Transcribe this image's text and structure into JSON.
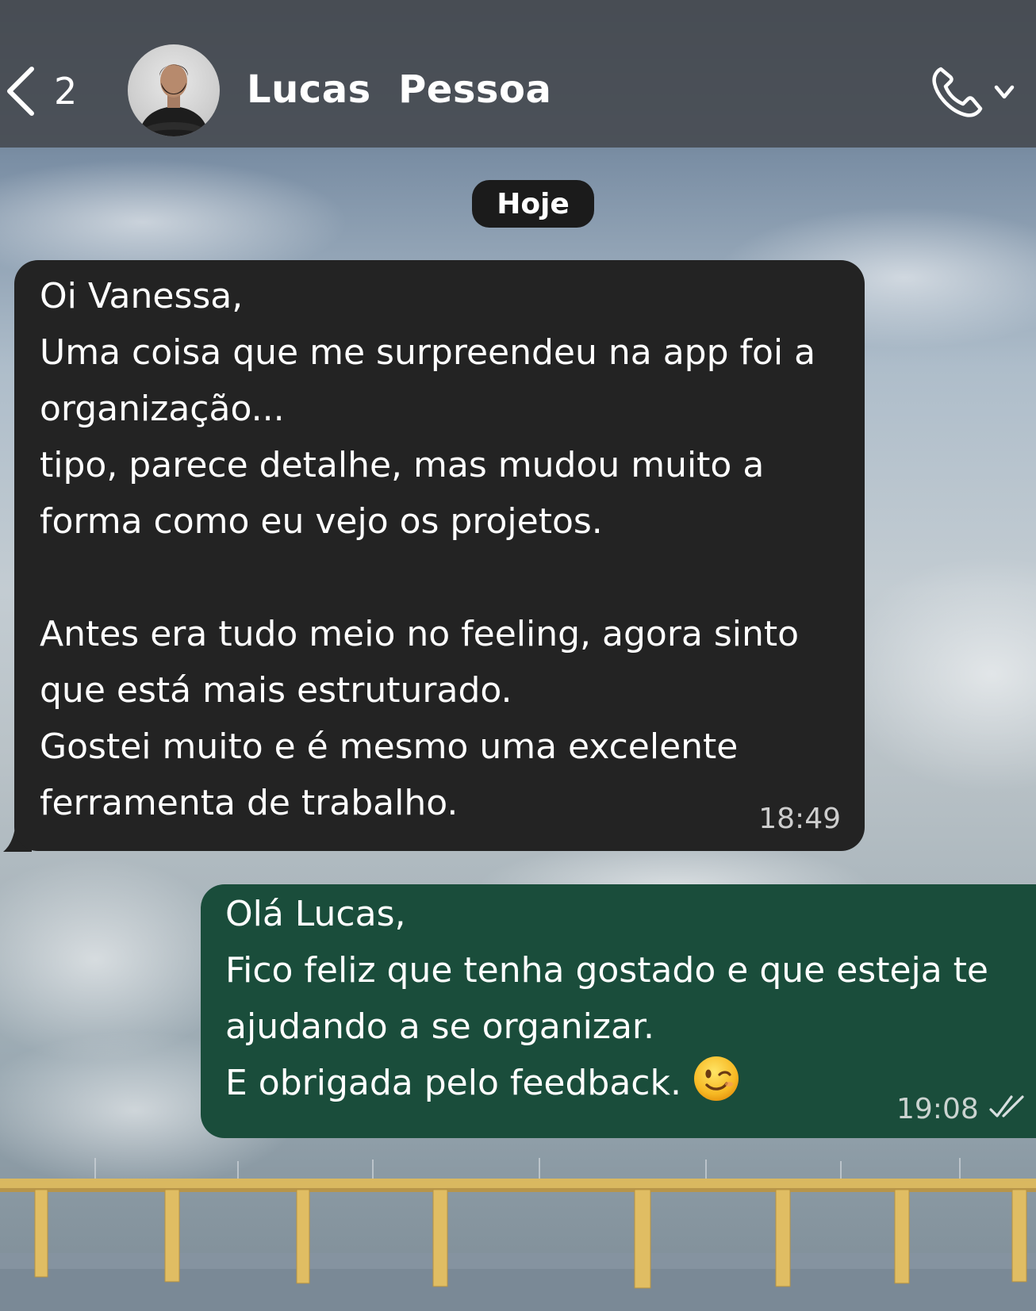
{
  "header": {
    "back_count": "2",
    "contact_name": "Lucas  Pessoa",
    "call_icon": "phone-icon",
    "dropdown_icon": "chevron-down-icon",
    "background": "#484c52"
  },
  "date_divider": {
    "label": "Hoje"
  },
  "messages": [
    {
      "direction": "incoming",
      "text": "Oi Vanessa,\nUma coisa que me surpreendeu na app foi a organização...\ntipo, parece detalhe, mas mudou muito a forma como eu vejo os projetos.\n\nAntes era tudo meio no feeling, agora sinto que está mais estruturado.\nGostei muito e é mesmo uma excelente ferramenta de trabalho.",
      "time": "18:49",
      "bubble_color": "#232323"
    },
    {
      "direction": "outgoing",
      "text": "Olá Lucas,\nFico feliz que tenha gostado e que esteja te ajudando a se organizar.\nE obrigada pelo feedback.",
      "emoji": "winking-face-emoji",
      "time": "19:08",
      "status_icon": "double-check-icon",
      "bubble_color": "#1a4d3b"
    }
  ],
  "colors": {
    "header_text": "#ffffff",
    "date_pill": "#1b1b1b",
    "bridge": "#d6b35a"
  }
}
